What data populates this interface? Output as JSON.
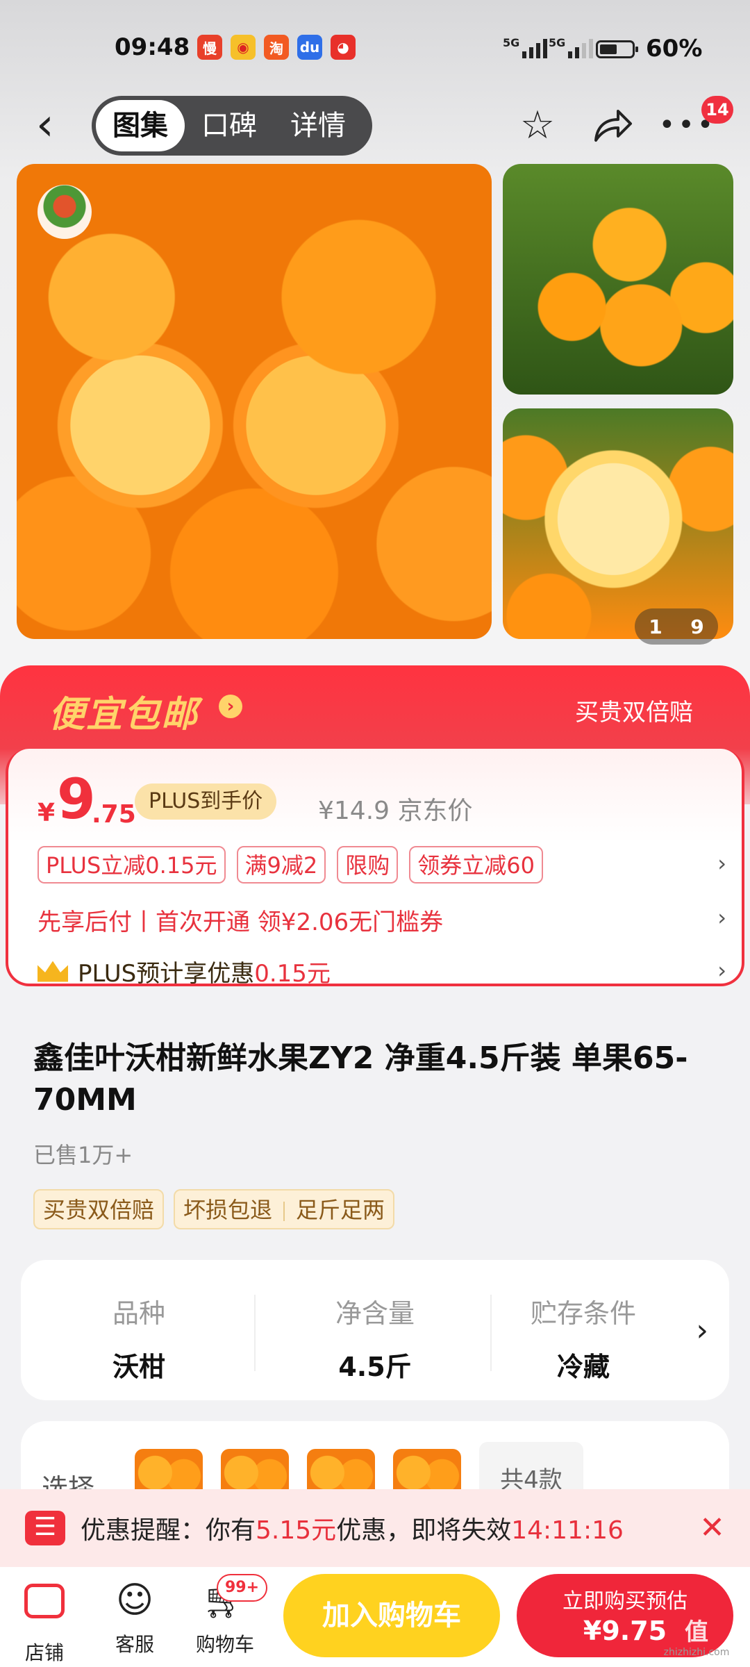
{
  "status": {
    "time": "09:48",
    "signal1": "5G",
    "signal2": "5G",
    "battery_pct": "60%",
    "battery_level": 0.6
  },
  "nav": {
    "back_icon": "back-chevron-icon",
    "tabs": [
      "图集",
      "口碑",
      "详情"
    ],
    "active_tab": 0,
    "more_badge": "14"
  },
  "gallery": {
    "counter_current": "1",
    "counter_total": "9"
  },
  "promo": {
    "title": "便宜包邮",
    "right_text": "买贵双倍赔",
    "price_symbol": "¥",
    "price_int": "9",
    "price_dec": ".75",
    "plus_tag": "PLUS到手价",
    "jd_price": "¥14.9",
    "jd_label": "京东价",
    "coupons": [
      "PLUS立减0.15元",
      "满9减2",
      "限购",
      "领券立减60"
    ],
    "paylater": "先享后付丨首次开通 领¥2.06无门槛券",
    "plus_line_prefix": "PLUS预计享优惠",
    "plus_line_amount": "0.15元"
  },
  "product": {
    "title": "鑫佳叶沃柑新鲜水果ZY2 净重4.5斤装 单果65-70MM",
    "sold": "已售1万+",
    "tags": [
      "买贵双倍赔",
      "坏损包退",
      "足斤足两"
    ]
  },
  "specs": [
    {
      "k": "品种",
      "v": "沃柑"
    },
    {
      "k": "净含量",
      "v": "4.5斤"
    },
    {
      "k": "贮存条件",
      "v": "冷藏"
    }
  ],
  "select": {
    "label": "选择",
    "more": "共4款"
  },
  "reminder": {
    "prefix": "优惠提醒：你有",
    "amount": "5.15元",
    "mid": "优惠，即将失效",
    "countdown": "14:11:16"
  },
  "bottom": {
    "store": "店铺",
    "service": "客服",
    "cart": "购物车",
    "cart_badge": "99+",
    "add_cart": "加入购物车",
    "buy_line1": "立即购买预估",
    "buy_line2": "¥9.75"
  },
  "watermark": {
    "logo": "值",
    "site": "zhizhizhi.com"
  }
}
